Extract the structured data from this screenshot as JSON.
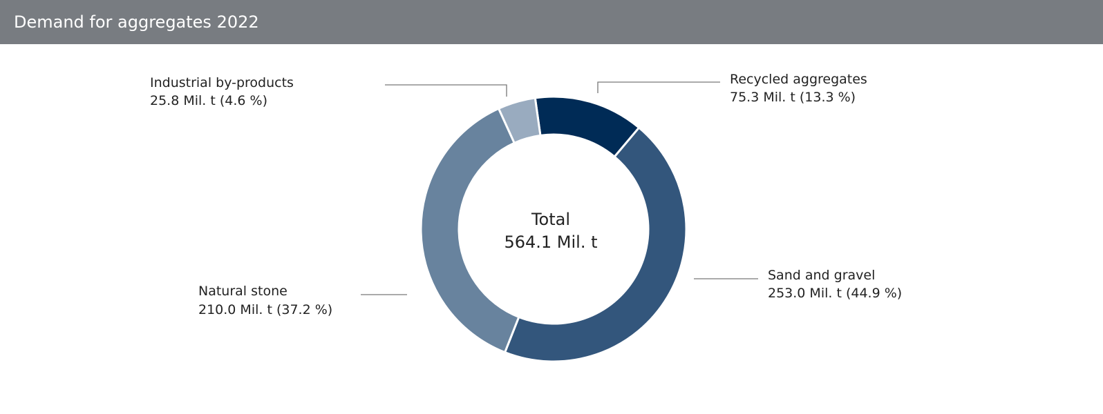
{
  "header": {
    "title": "Demand for aggregates 2022"
  },
  "chart_data": {
    "type": "pie",
    "title": "Demand for aggregates 2022",
    "unit": "Mil. t",
    "total": {
      "label": "Total",
      "value_text": "564.1 Mil. t",
      "value": 564.1
    },
    "slices": [
      {
        "name": "Recycled aggregates",
        "value": 75.3,
        "percent": 13.3,
        "value_text": "75.3 Mil. t (13.3 %)",
        "color": "#002b56"
      },
      {
        "name": "Sand and gravel",
        "value": 253.0,
        "percent": 44.9,
        "value_text": "253.0 Mil. t (44.9 %)",
        "color": "#33567c"
      },
      {
        "name": "Natural stone",
        "value": 210.0,
        "percent": 37.2,
        "value_text": "210.0 Mil. t (37.2 %)",
        "color": "#68839e"
      },
      {
        "name": "Industrial by-products",
        "value": 25.8,
        "percent": 4.6,
        "value_text": "25.8 Mil. t (4.6 %)",
        "color": "#99abbf"
      }
    ]
  }
}
